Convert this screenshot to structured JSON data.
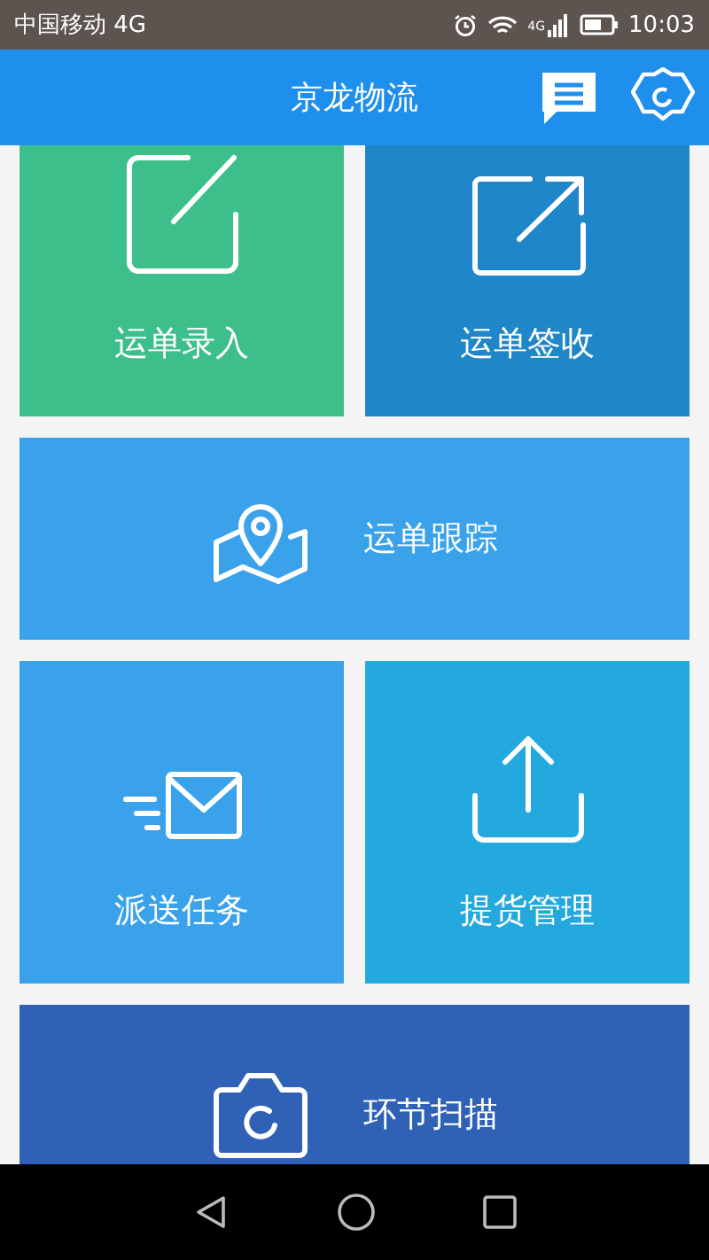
{
  "status_bar": {
    "carrier": "中国移动 4G",
    "network": "4G",
    "time": "10:03"
  },
  "app_bar": {
    "title": "京龙物流"
  },
  "tiles": [
    {
      "kind": "square",
      "label": "运单录入",
      "color": "#3dbf8c"
    },
    {
      "kind": "square",
      "label": "运单签收",
      "color": "#1e86c9"
    },
    {
      "kind": "wide",
      "label": "运单跟踪",
      "color": "#3aa2ea"
    },
    {
      "kind": "square",
      "label": "派送任务",
      "color": "#3aa2ea"
    },
    {
      "kind": "square",
      "label": "提货管理",
      "color": "#24a9de"
    },
    {
      "kind": "wide",
      "label": "环节扫描",
      "color": "#2f62b6"
    }
  ]
}
